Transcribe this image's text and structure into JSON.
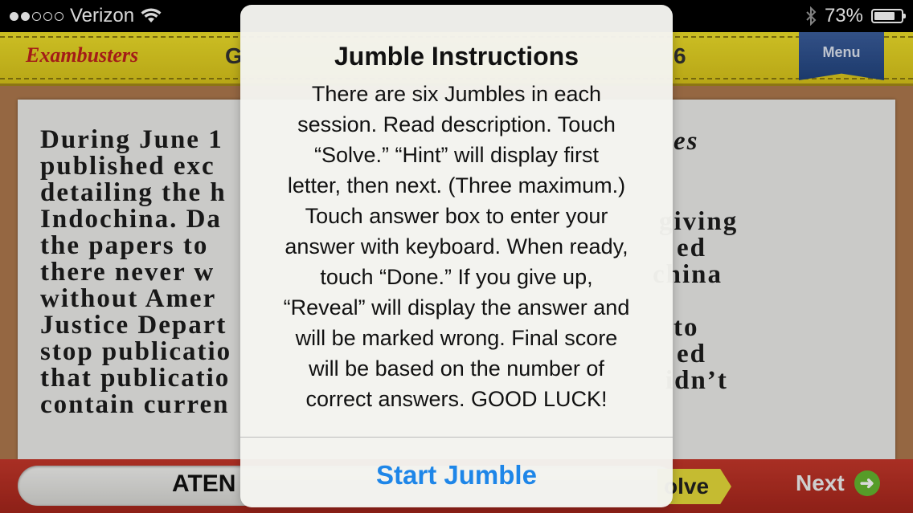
{
  "status_bar": {
    "carrier": "Verizon",
    "signal_bars_filled": 2,
    "signal_bars_total": 5,
    "battery_percent_label": "73%",
    "battery_level": 0.73
  },
  "header": {
    "logo": "Exambusters",
    "left_text_fragment": "G",
    "right_text_fragment": "6",
    "menu_label": "Menu"
  },
  "content": {
    "paragraph_lines": [
      "During June 1",
      "published exc",
      "detailing the h",
      "Indochina. Da",
      "the papers to",
      "there never w",
      "without Amer",
      "Justice Depart",
      "stop publicatio",
      "that publicatio",
      "contain curren"
    ],
    "right_fragments": [
      "es",
      "giving",
      "ed",
      "china",
      "to",
      "ed",
      "idn’t"
    ]
  },
  "bottom_bar": {
    "answer_text": "ATEN",
    "solve_label": "olve",
    "next_label": "Next"
  },
  "modal": {
    "title": "Jumble Instructions",
    "body_lines": [
      "There are six Jumbles in each",
      "session. Read description. Touch",
      "“Solve.” “Hint” will display first",
      "letter, then next. (Three maximum.)",
      "Touch answer box to enter your",
      "answer with keyboard. When ready,",
      "touch “Done.” If you give up,",
      "“Reveal” will display the answer and",
      "will be marked wrong. Final score",
      "will be based on the number of",
      "correct answers. GOOD LUCK!"
    ],
    "button_label": "Start Jumble"
  },
  "colors": {
    "header_yellow": "#e6d427",
    "logo_red": "#c0211d",
    "menu_blue": "#2d518f",
    "bottom_red": "#b52d21",
    "link_blue": "#1e86e8",
    "next_green": "#66b82f"
  }
}
